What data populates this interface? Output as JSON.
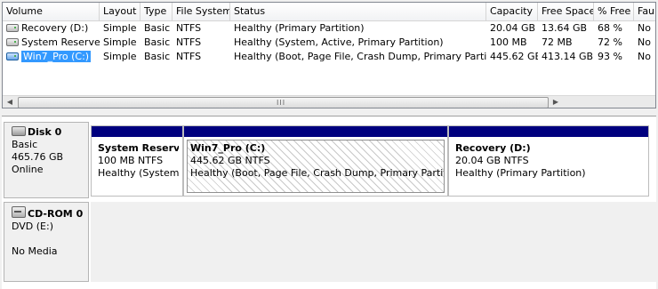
{
  "volume_list": {
    "columns": [
      "Volume",
      "Layout",
      "Type",
      "File System",
      "Status",
      "Capacity",
      "Free Space",
      "% Free",
      "Fau"
    ],
    "rows": [
      {
        "volume": "Recovery (D:)",
        "layout": "Simple",
        "type": "Basic",
        "fs": "NTFS",
        "status": "Healthy (Primary Partition)",
        "capacity": "20.04 GB",
        "free": "13.64 GB",
        "pct": "68 %",
        "fault": "No",
        "selected": false
      },
      {
        "volume": "System Reserved",
        "layout": "Simple",
        "type": "Basic",
        "fs": "NTFS",
        "status": "Healthy (System, Active, Primary Partition)",
        "capacity": "100 MB",
        "free": "72 MB",
        "pct": "72 %",
        "fault": "No",
        "selected": false
      },
      {
        "volume": "Win7_Pro (C:)",
        "layout": "Simple",
        "type": "Basic",
        "fs": "NTFS",
        "status": "Healthy (Boot, Page File, Crash Dump, Primary Partition)",
        "capacity": "445.62 GB",
        "free": "413.14 GB",
        "pct": "93 %",
        "fault": "No",
        "selected": true
      }
    ],
    "scroll_grip": "III"
  },
  "disks": [
    {
      "title": "Disk 0",
      "lines": [
        "Basic",
        "465.76 GB",
        "Online"
      ],
      "partitions": [
        {
          "name": "System Reserved",
          "size": "100 MB NTFS",
          "status": "Healthy (System, A",
          "hatched": false
        },
        {
          "name": "Win7_Pro  (C:)",
          "size": "445.62 GB NTFS",
          "status": "Healthy (Boot, Page File, Crash Dump, Primary Partition)",
          "hatched": true
        },
        {
          "name": "Recovery  (D:)",
          "size": "20.04 GB NTFS",
          "status": "Healthy (Primary Partition)",
          "hatched": false
        }
      ]
    },
    {
      "title": "CD-ROM 0",
      "lines": [
        "DVD (E:)",
        "",
        "No Media"
      ]
    }
  ],
  "icons": {
    "volume": "volume-drive-icon",
    "disk": "disk-icon",
    "cdrom": "cdrom-icon"
  },
  "colors": {
    "partition_bar": "#00007f",
    "selection": "#3399ff"
  }
}
